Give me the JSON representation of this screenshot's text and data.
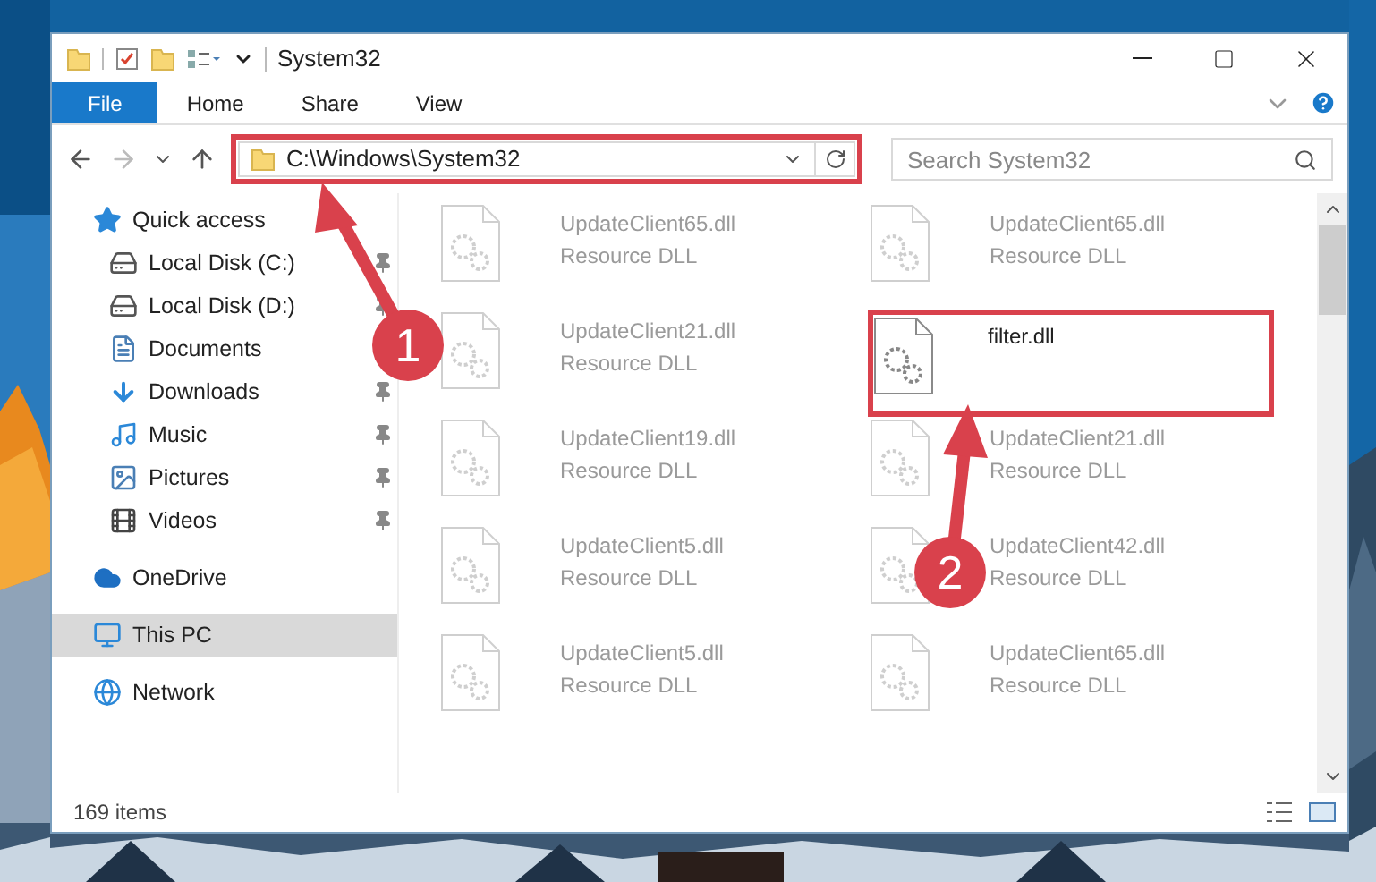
{
  "window": {
    "title": "System32"
  },
  "ribbon_tabs": [
    {
      "label": "File",
      "selected": true
    },
    {
      "label": "Home",
      "selected": false
    },
    {
      "label": "Share",
      "selected": false
    },
    {
      "label": "View",
      "selected": false
    }
  ],
  "address_bar": {
    "path": "C:\\Windows\\System32"
  },
  "search": {
    "placeholder": "Search System32"
  },
  "sidebar": {
    "items": [
      {
        "label": "Quick access",
        "kind": "star",
        "selected": false,
        "children": [
          {
            "label": "Local Disk (C:)",
            "kind": "system-drive",
            "pinned": true
          },
          {
            "label": "Local Disk (D:)",
            "kind": "drive",
            "pinned": true
          },
          {
            "label": "Documents",
            "kind": "documents"
          },
          {
            "label": "Downloads",
            "kind": "downloads",
            "pinned": true
          },
          {
            "label": "Music",
            "kind": "music",
            "pinned": true
          },
          {
            "label": "Pictures",
            "kind": "pictures",
            "pinned": true
          },
          {
            "label": "Videos",
            "kind": "videos",
            "pinned": true
          }
        ]
      },
      {
        "label": "OneDrive",
        "kind": "cloud",
        "selected": false
      },
      {
        "label": "This PC",
        "kind": "computer",
        "selected": true
      },
      {
        "label": "Network",
        "kind": "network",
        "selected": false
      }
    ]
  },
  "files": [
    {
      "name": "UpdateClient65.dll",
      "type": "Resource DLL",
      "faded": true
    },
    {
      "name": "UpdateClient65.dll",
      "type": "Resource DLL",
      "faded": true
    },
    {
      "name": "UpdateClient21.dll",
      "type": "Resource DLL",
      "faded": true
    },
    {
      "name": "filter.dll",
      "faded": false
    },
    {
      "name": "UpdateClient19.dll",
      "type": "Resource DLL",
      "faded": true
    },
    {
      "name": "UpdateClient21.dll",
      "type": "Resource DLL",
      "faded": true
    },
    {
      "name": "UpdateClient5.dll",
      "type": "Resource DLL",
      "faded": true
    },
    {
      "name": "UpdateClient42.dll",
      "type": "Resource DLL",
      "faded": true
    },
    {
      "name": "UpdateClient5.dll",
      "type": "Resource DLL",
      "faded": true
    },
    {
      "name": "UpdateClient65.dll",
      "type": "Resource DLL",
      "faded": true
    }
  ],
  "status_bar": {
    "item_count": "169 items"
  },
  "callouts": [
    {
      "number": "1"
    },
    {
      "number": "2"
    }
  ]
}
